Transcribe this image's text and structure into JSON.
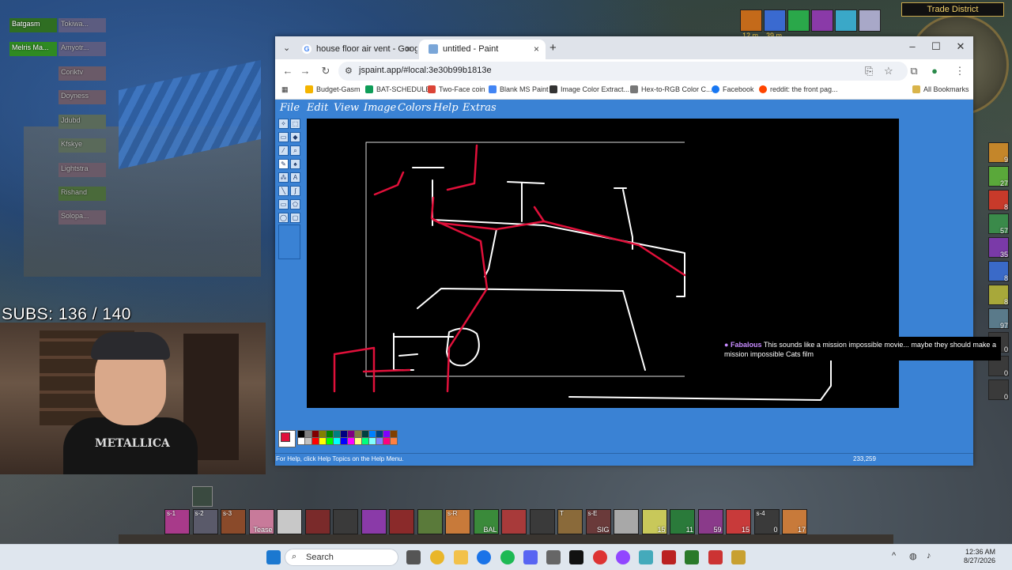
{
  "game": {
    "zone": "Trade District",
    "subs": "SUBS: 136 / 140",
    "raid": [
      {
        "name": "Batgasm",
        "color": "#2f6e22",
        "dim": false
      },
      {
        "name": "Tokiwa...",
        "color": "#5c5c80",
        "dim": true
      },
      {
        "name": "Melris Ma...",
        "color": "#2f8a22",
        "dim": false
      },
      {
        "name": "Amyotr...",
        "color": "#5c5c80",
        "dim": true
      },
      {
        "name": "Coriktv",
        "color": "#6a5a68",
        "dim": true
      },
      {
        "name": "Doyness",
        "color": "#6a5a68",
        "dim": true
      },
      {
        "name": "Jdubd",
        "color": "#5a6a5a",
        "dim": true
      },
      {
        "name": "Kfskye",
        "color": "#5a6a5a",
        "dim": true
      },
      {
        "name": "Lightstra",
        "color": "#6a5a68",
        "dim": true
      },
      {
        "name": "Rishand",
        "color": "#4a6a3a",
        "dim": true
      },
      {
        "name": "Solopa...",
        "color": "#6a5a68",
        "dim": true
      }
    ],
    "buff_timers": [
      "12 m",
      "39 m"
    ],
    "webcam_shirt": "METALLICA",
    "sidebar_counts": [
      "9",
      "27",
      "8",
      "57",
      "35",
      "8",
      "8",
      "97",
      "0",
      "0",
      "0"
    ],
    "actionbar": [
      {
        "key": "s-1",
        "count": ""
      },
      {
        "key": "s-2",
        "count": ""
      },
      {
        "key": "s-3",
        "count": ""
      },
      {
        "key": "",
        "count": "Tease"
      },
      {
        "key": "",
        "count": ""
      },
      {
        "key": "",
        "count": ""
      },
      {
        "key": "",
        "count": ""
      },
      {
        "key": "",
        "count": ""
      },
      {
        "key": "",
        "count": ""
      },
      {
        "key": "",
        "count": ""
      },
      {
        "key": "s-R",
        "count": ""
      },
      {
        "key": "",
        "count": "BAL"
      },
      {
        "key": "",
        "count": ""
      },
      {
        "key": "",
        "count": ""
      },
      {
        "key": "T",
        "count": ""
      },
      {
        "key": "s-E",
        "count": "SIG"
      },
      {
        "key": "",
        "count": ""
      },
      {
        "key": "",
        "count": "15"
      },
      {
        "key": "",
        "count": "11"
      },
      {
        "key": "",
        "count": "59"
      },
      {
        "key": "",
        "count": "15"
      },
      {
        "key": "s-4",
        "count": "0"
      },
      {
        "key": "",
        "count": "17"
      }
    ]
  },
  "browser": {
    "tabs": [
      {
        "title": "house floor air vent - Google S...",
        "favicon": "G",
        "active": false
      },
      {
        "title": "untitled - Paint",
        "favicon": "",
        "active": true
      }
    ],
    "url": "jspaint.app/#local:3e30b99b1813e",
    "bookmarks": [
      {
        "label": "Budget-Gasm",
        "color": "#f4b400"
      },
      {
        "label": "BAT-SCHEDULE",
        "color": "#0f9d58"
      },
      {
        "label": "Two-Face coin",
        "color": "#db4437"
      },
      {
        "label": "Blank MS Paint",
        "color": "#4285f4"
      },
      {
        "label": "Image Color Extract...",
        "color": "#333333"
      },
      {
        "label": "Hex-to-RGB Color C...",
        "color": "#777777"
      },
      {
        "label": "Facebook",
        "color": "#1877f2"
      },
      {
        "label": "reddit: the front pag...",
        "color": "#ff4500"
      }
    ],
    "all_bookmarks": "All Bookmarks"
  },
  "paint": {
    "menus": [
      "File",
      "Edit",
      "View",
      "Image",
      "Colors",
      "Help",
      "Extras"
    ],
    "status_text": "For Help, click Help Topics on the Help Menu.",
    "coords": "233,259",
    "colors": [
      "#000000",
      "#808080",
      "#800000",
      "#808000",
      "#008000",
      "#008080",
      "#000080",
      "#800080",
      "#808040",
      "#004040",
      "#0080ff",
      "#004080",
      "#8000ff",
      "#804000",
      "#ffffff",
      "#c0c0c0",
      "#ff0000",
      "#ffff00",
      "#00ff00",
      "#00ffff",
      "#0000ff",
      "#ff00ff",
      "#ffff80",
      "#00ff80",
      "#80ffff",
      "#8080ff",
      "#ff0080",
      "#ff8040"
    ],
    "chat": {
      "name": "Fabalous",
      "message": "This sounds like a mission impossible movie... maybe they should make a mission impossible Cats film"
    }
  },
  "taskbar": {
    "search": "Search",
    "time": "12:36 AM",
    "date": "8/27/2026"
  }
}
